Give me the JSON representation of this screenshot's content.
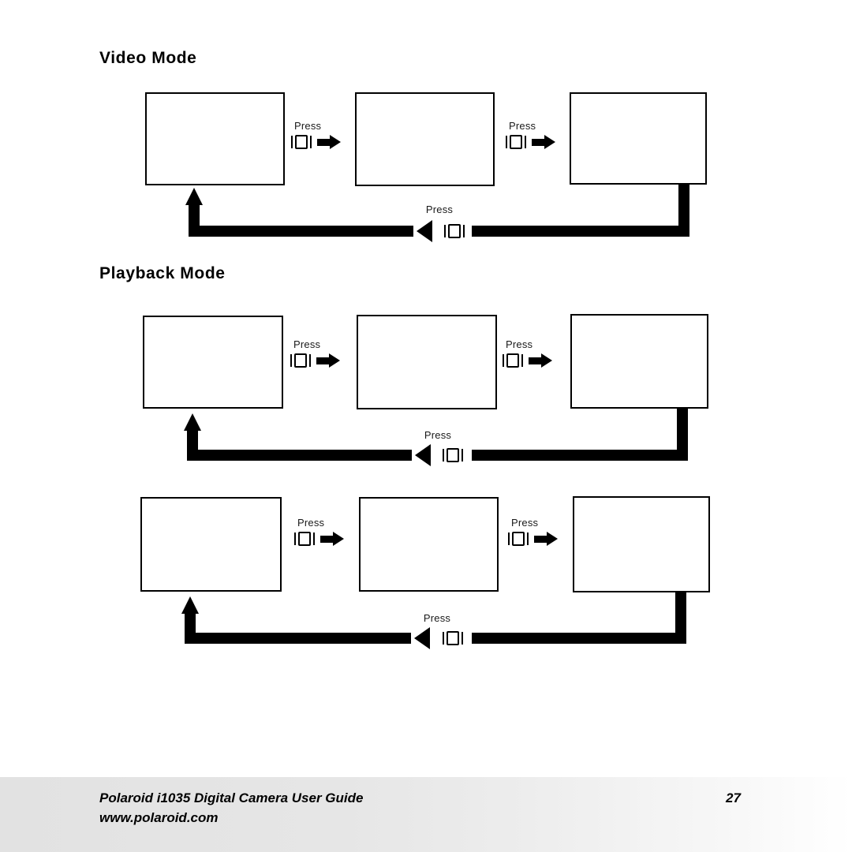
{
  "document": {
    "sections": [
      {
        "id": "video-mode",
        "heading": "Video Mode"
      },
      {
        "id": "playback-mode",
        "heading": "Playback Mode"
      }
    ]
  },
  "diagrams": [
    {
      "id": "video-mode-flow",
      "belongs_to": "Video Mode",
      "screens": [
        "",
        "",
        ""
      ],
      "transitions": [
        {
          "label": "Press",
          "icon": "mode-button-icon",
          "direction": "right"
        },
        {
          "label": "Press",
          "icon": "mode-button-icon",
          "direction": "right"
        },
        {
          "label": "Press",
          "icon": "mode-button-icon",
          "direction": "left"
        }
      ]
    },
    {
      "id": "playback-mode-flow-1",
      "belongs_to": "Playback Mode",
      "screens": [
        "",
        "",
        ""
      ],
      "transitions": [
        {
          "label": "Press",
          "icon": "mode-button-icon",
          "direction": "right"
        },
        {
          "label": "Press",
          "icon": "mode-button-icon",
          "direction": "right"
        },
        {
          "label": "Press",
          "icon": "mode-button-icon",
          "direction": "left"
        }
      ]
    },
    {
      "id": "playback-mode-flow-2",
      "belongs_to": "Playback Mode",
      "screens": [
        "",
        "",
        ""
      ],
      "transitions": [
        {
          "label": "Press",
          "icon": "mode-button-icon",
          "direction": "right"
        },
        {
          "label": "Press",
          "icon": "mode-button-icon",
          "direction": "right"
        },
        {
          "label": "Press",
          "icon": "mode-button-icon",
          "direction": "left"
        }
      ]
    }
  ],
  "footer": {
    "line1": "Polaroid i1035 Digital Camera User Guide",
    "line2": "www.polaroid.com",
    "page_number": "27"
  },
  "colors": {
    "ink": "#000000",
    "paper": "#ffffff",
    "footer_band_start": "#e2e2e2",
    "footer_band_end": "#ffffff"
  }
}
